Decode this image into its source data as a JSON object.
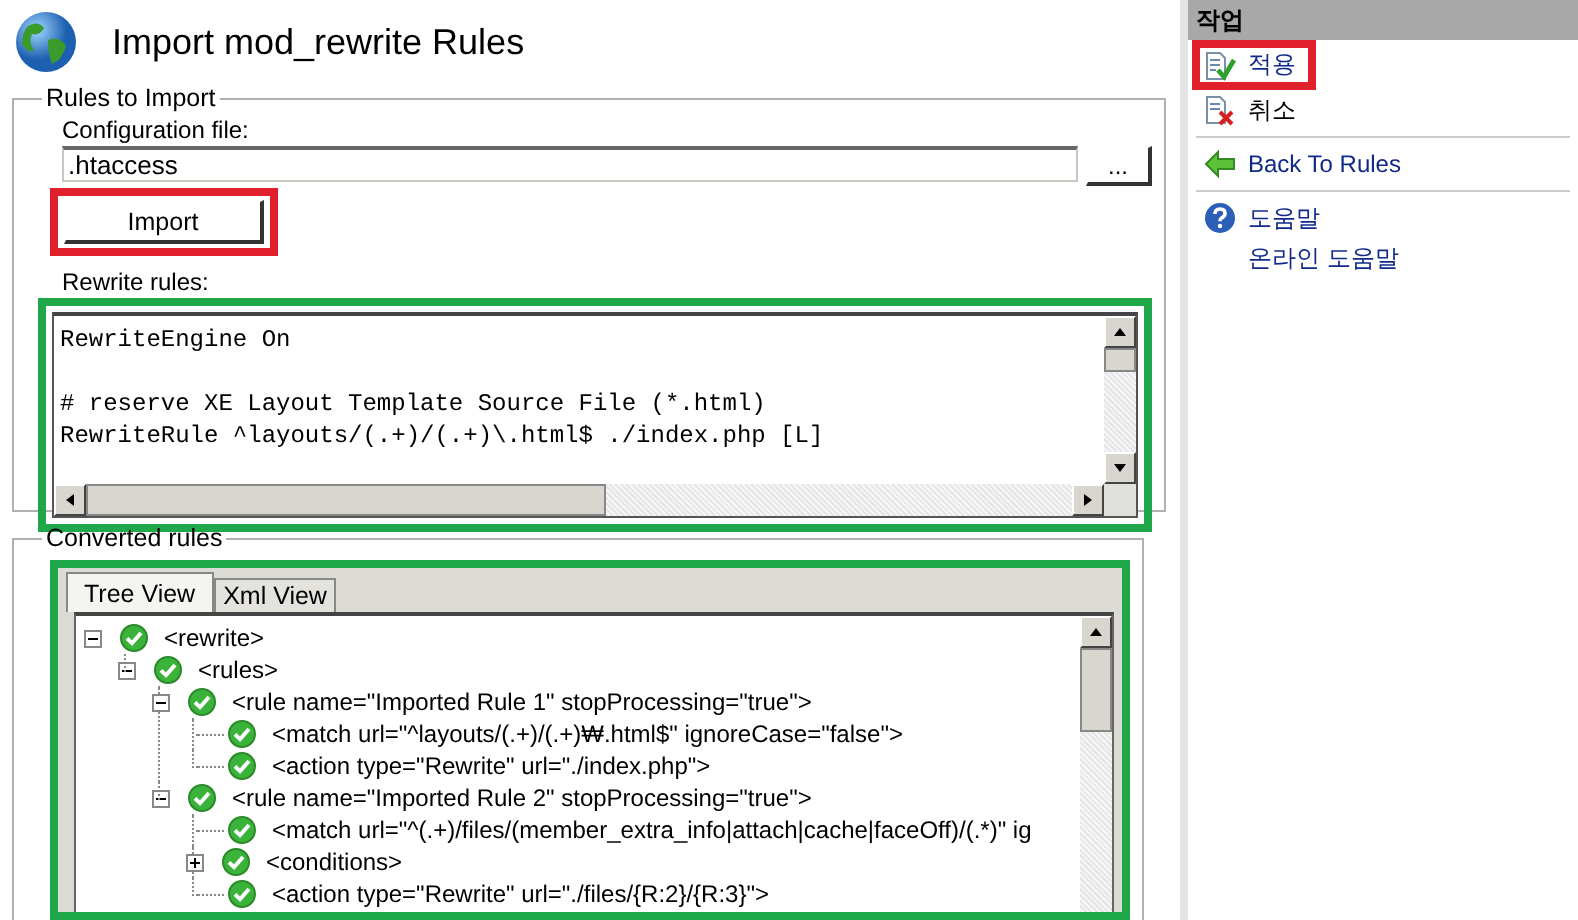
{
  "page": {
    "title": "Import mod_rewrite Rules"
  },
  "rules_to_import": {
    "legend": "Rules to Import",
    "config_label": "Configuration file:",
    "config_value": ".htaccess",
    "browse_button": "...",
    "import_button": "Import",
    "rewrite_label": "Rewrite rules:",
    "rewrite_text": "RewriteEngine On\n\n# reserve XE Layout Template Source File (*.html)\nRewriteRule ^layouts/(.+)/(.+)\\.html$ ./index.php [L]"
  },
  "converted_rules": {
    "legend": "Converted rules",
    "tabs": [
      {
        "label": "Tree View",
        "selected": true
      },
      {
        "label": "Xml View",
        "selected": false
      }
    ],
    "tree": [
      {
        "text": "<rewrite>",
        "expanded": true,
        "children": [
          {
            "text": "<rules>",
            "expanded": true,
            "children": [
              {
                "text": "<rule name=\"Imported Rule 1\" stopProcessing=\"true\">",
                "expanded": true,
                "children": [
                  {
                    "text": "<match url=\"^layouts/(.+)/(.+)₩.html$\" ignoreCase=\"false\">"
                  },
                  {
                    "text": "<action type=\"Rewrite\" url=\"./index.php\">"
                  }
                ]
              },
              {
                "text": "<rule name=\"Imported Rule 2\" stopProcessing=\"true\">",
                "expanded": true,
                "children": [
                  {
                    "text": "<match url=\"^(.+)/files/(member_extra_info|attach|cache|faceOff)/(.*)\" ig"
                  },
                  {
                    "text": "<conditions>",
                    "expanded": false
                  },
                  {
                    "text": "<action type=\"Rewrite\" url=\"./files/{R:2}/{R:3}\">"
                  }
                ]
              }
            ]
          }
        ]
      }
    ]
  },
  "actions": {
    "title": "작업",
    "items": [
      {
        "kind": "apply",
        "label": "적용"
      },
      {
        "kind": "cancel",
        "label": "취소"
      },
      {
        "kind": "back",
        "label": "Back To Rules"
      },
      {
        "kind": "help",
        "label": "도움말"
      },
      {
        "kind": "link",
        "label": "온라인 도움말"
      }
    ]
  }
}
